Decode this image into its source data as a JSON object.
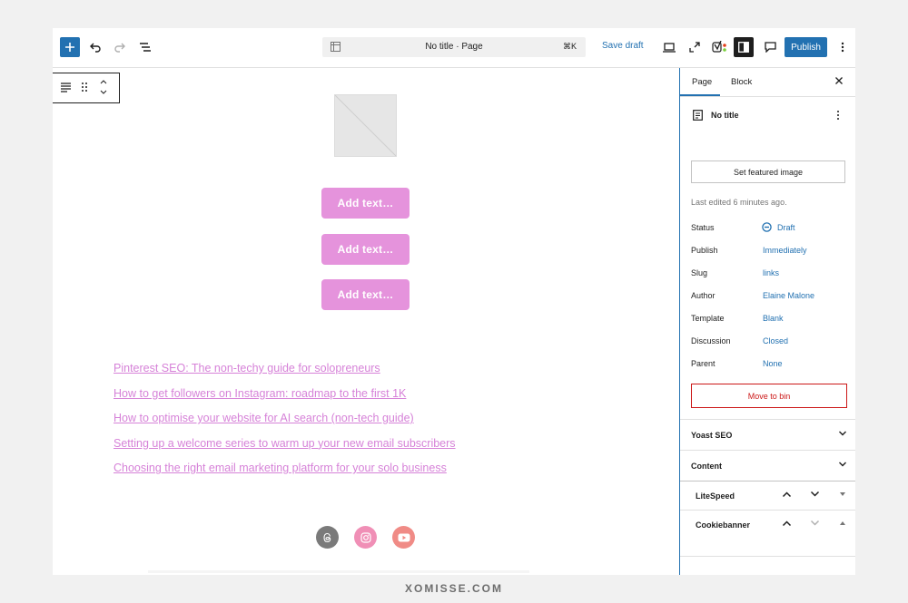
{
  "topbar": {
    "document_title": "No title · Page",
    "shortcut": "⌘K",
    "save_draft_label": "Save draft",
    "publish_label": "Publish"
  },
  "canvas": {
    "buttons": [
      "Add text…",
      "Add text…",
      "Add text…"
    ],
    "links": [
      "Pinterest SEO: The non-techy guide for solopreneurs",
      "How to get followers on Instagram: roadmap to the first 1K",
      "How to optimise your website for AI search (non-tech guide)",
      "Setting up a welcome series to warm up your new email subscribers",
      "Choosing the right email marketing platform for your solo business"
    ],
    "social_icons": [
      "threads-icon",
      "instagram-icon",
      "youtube-icon"
    ]
  },
  "sidebar": {
    "tabs": {
      "page": "Page",
      "block": "Block"
    },
    "doc_title": "No title",
    "featured_image_label": "Set featured image",
    "last_edited": "Last edited 6 minutes ago.",
    "fields": {
      "status": {
        "label": "Status",
        "value": "Draft"
      },
      "publish": {
        "label": "Publish",
        "value": "Immediately"
      },
      "slug": {
        "label": "Slug",
        "value": "links"
      },
      "author": {
        "label": "Author",
        "value": "Elaine Malone"
      },
      "template": {
        "label": "Template",
        "value": "Blank"
      },
      "discussion": {
        "label": "Discussion",
        "value": "Closed"
      },
      "parent": {
        "label": "Parent",
        "value": "None"
      }
    },
    "move_to_bin_label": "Move to bin",
    "panels": {
      "yoast": "Yoast SEO",
      "content": "Content"
    }
  },
  "meta_boxes": {
    "litespeed": "LiteSpeed",
    "cookiebanner": "Cookiebanner"
  },
  "footer": {
    "brand": "XOMISSE.COM"
  },
  "colors": {
    "accent": "#2271b1",
    "button_pink": "#e593dc",
    "link_pink": "#d682d8",
    "danger": "#cc1818"
  }
}
